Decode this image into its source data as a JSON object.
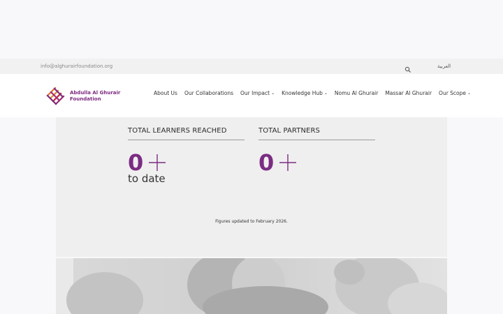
{
  "topbar": {
    "email": "info@alghurairfoundation.org",
    "language": "العربية",
    "search_icon": "search-icon"
  },
  "brand": {
    "line1": "Abdulla Al Ghurair",
    "line2": "Foundation",
    "colors": {
      "purple": "#7d2a80",
      "orange": "#e8742a",
      "red": "#c8242f"
    }
  },
  "nav": {
    "items": [
      {
        "label": "About Us",
        "dropdown": false
      },
      {
        "label": "Our Collaborations",
        "dropdown": false
      },
      {
        "label": "Our Impact",
        "dropdown": true
      },
      {
        "label": "Knowledge Hub",
        "dropdown": true
      },
      {
        "label": "Nomu Al Ghurair",
        "dropdown": false
      },
      {
        "label": "Massar Al Ghurair",
        "dropdown": false
      },
      {
        "label": "Our Scope",
        "dropdown": true
      }
    ],
    "chevron": "⌄"
  },
  "stats": {
    "items": [
      {
        "label": "TOTAL LEARNERS REACHED",
        "value": "0",
        "suffix": "to date"
      },
      {
        "label": "TOTAL PARTNERS",
        "value": "0",
        "suffix": ""
      }
    ],
    "note": "Figures updated to February 2026.",
    "accent": "#7b2c83"
  }
}
